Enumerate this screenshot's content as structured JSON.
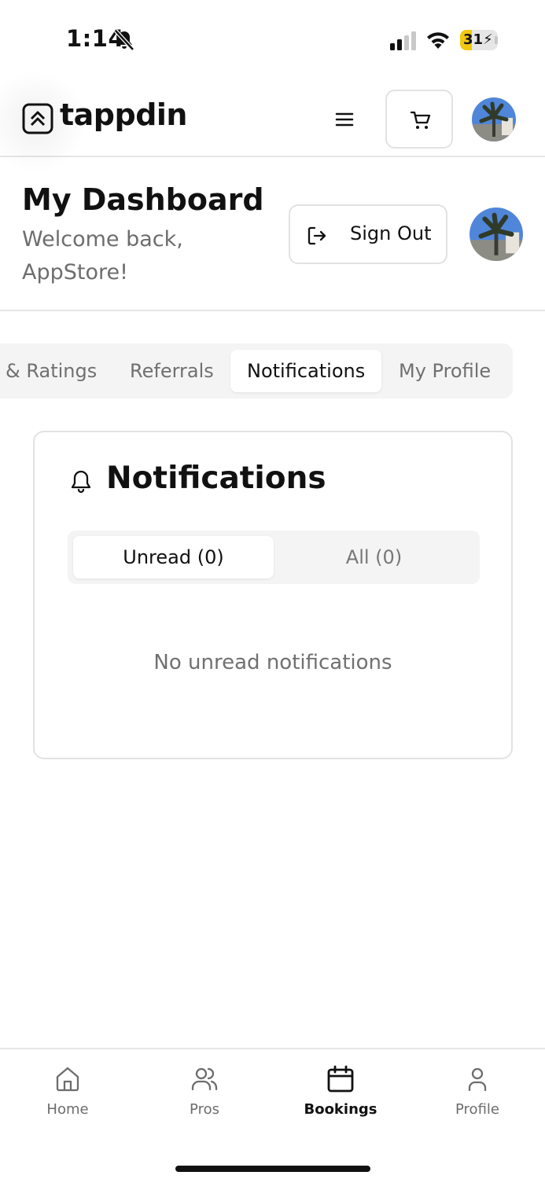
{
  "status_bar": {
    "time": "1:14",
    "battery_percent": "31",
    "battery_level": 0.31,
    "icons": [
      "bell-slash-icon",
      "cellular-signal-icon",
      "wifi-icon",
      "battery-charging-icon"
    ]
  },
  "header": {
    "logo_text": "tappdin",
    "logo_icon": "chevrons-up-icon",
    "menu_icon": "hamburger-menu-icon",
    "cart_icon": "shopping-cart-icon",
    "avatar_icon": "user-avatar"
  },
  "dashboard": {
    "title": "My Dashboard",
    "welcome": "Welcome back, AppStore!",
    "sign_out_label": "Sign Out",
    "sign_out_icon": "log-out-icon"
  },
  "tabs": [
    {
      "label": "& Ratings",
      "active": false
    },
    {
      "label": "Referrals",
      "active": false
    },
    {
      "label": "Notifications",
      "active": true
    },
    {
      "label": "My Profile",
      "active": false
    }
  ],
  "notifications": {
    "title": "Notifications",
    "icon": "bell-icon",
    "filters": [
      {
        "label": "Unread (0)",
        "active": true
      },
      {
        "label": "All (0)",
        "active": false
      }
    ],
    "empty_message": "No unread notifications"
  },
  "bottom_nav": [
    {
      "label": "Home",
      "icon": "home-icon",
      "active": false
    },
    {
      "label": "Pros",
      "icon": "users-icon",
      "active": false
    },
    {
      "label": "Bookings",
      "icon": "calendar-icon",
      "active": true
    },
    {
      "label": "Profile",
      "icon": "person-icon",
      "active": false
    }
  ],
  "colors": {
    "text_primary": "#111111",
    "text_muted": "#707070",
    "border": "#e2e2e2",
    "tab_bg": "#f4f4f4",
    "battery_yellow": "#f2c80f"
  }
}
